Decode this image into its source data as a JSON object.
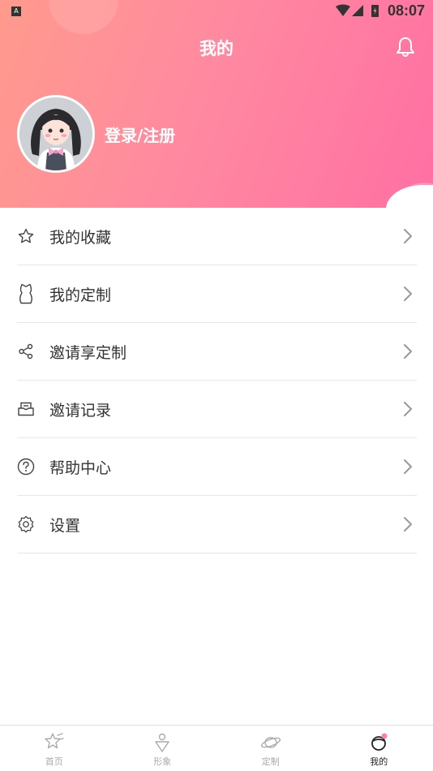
{
  "status_bar": {
    "time": "08:07",
    "notification_badge": "A"
  },
  "header": {
    "title": "我的",
    "login_text": "登录/注册"
  },
  "menu": [
    {
      "label": "我的收藏",
      "icon": "star-icon"
    },
    {
      "label": "我的定制",
      "icon": "garment-icon"
    },
    {
      "label": "邀请享定制",
      "icon": "share-icon"
    },
    {
      "label": "邀请记录",
      "icon": "record-icon"
    },
    {
      "label": "帮助中心",
      "icon": "help-icon"
    },
    {
      "label": "设置",
      "icon": "settings-icon"
    }
  ],
  "tabs": [
    {
      "label": "首页",
      "icon": "home-icon",
      "active": false
    },
    {
      "label": "形象",
      "icon": "image-icon",
      "active": false
    },
    {
      "label": "定制",
      "icon": "custom-icon",
      "active": false
    },
    {
      "label": "我的",
      "icon": "profile-icon",
      "active": true
    }
  ],
  "colors": {
    "accent": "#ff7fa4",
    "gradient_start": "#ff9a8c",
    "gradient_end": "#ff6fa3"
  }
}
